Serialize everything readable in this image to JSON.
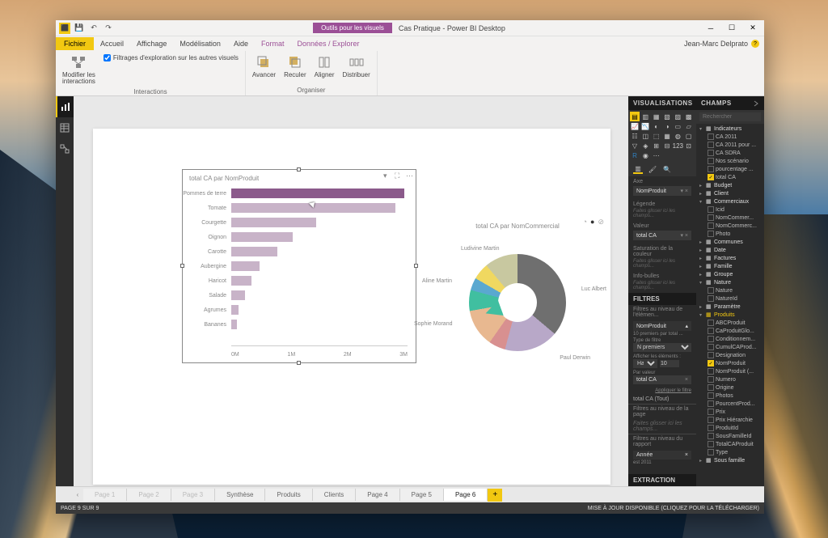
{
  "title_bar": {
    "contextual_tab": "Outils pour les visuels",
    "app_title": "Cas Pratique - Power BI Desktop",
    "user": "Jean-Marc Delprato"
  },
  "menu": {
    "file": "Fichier",
    "tabs": [
      "Accueil",
      "Affichage",
      "Modélisation",
      "Aide"
    ],
    "ctx_tabs": [
      "Format",
      "Données / Explorer"
    ]
  },
  "ribbon": {
    "interactions_group": "Interactions",
    "edit_btn": "Modifier les\ninteractions",
    "filter_check": "Filtrages d'exploration sur les autres visuels",
    "organiser_group": "Organiser",
    "avancer": "Avancer",
    "reculer": "Reculer",
    "aligner": "Aligner",
    "distribuer": "Distribuer"
  },
  "visualisations": {
    "header": "VISUALISATIONS",
    "axe_label": "Axe",
    "axe_field": "NomProduit",
    "legende_label": "Légende",
    "legende_placeholder": "Faites glisser ici les champs...",
    "valeur_label": "Valeur",
    "valeur_field": "total CA",
    "saturation_label": "Saturation de la couleur",
    "saturation_placeholder": "Faites glisser ici les champs...",
    "infobulles_label": "Info-bulles",
    "infobulles_placeholder": "Faites glisser ici les champs..."
  },
  "filtres": {
    "header": "FILTRES",
    "visual_level": "Filtres au niveau de l'élémen...",
    "nomproduit": "NomProduit",
    "sub": "10 premiers par total ...",
    "type_label": "Type de filtre",
    "type_value": "N premiers",
    "afficher_label": "Afficher les éléments :",
    "haut": "Haut",
    "haut_n": "10",
    "par_valeur": "Par valeur",
    "par_valeur_field": "total CA",
    "apply": "Appliquer le filtre",
    "totalca_tout": "total CA  (Tout)",
    "page_level": "Filtres au niveau de la page",
    "page_placeholder": "Faites glisser ici les champs...",
    "report_level": "Filtres au niveau du rapport",
    "annee": "Année",
    "annee_val": "est 2011"
  },
  "extraction": {
    "header": "EXTRACTION"
  },
  "champs": {
    "header": "CHAMPS",
    "search_placeholder": "Rechercher",
    "tree": [
      {
        "type": "table",
        "label": "Indicateurs",
        "expanded": true,
        "children": [
          {
            "label": "CA 2011",
            "checked": false
          },
          {
            "label": "CA 2011 pour ...",
            "checked": false
          },
          {
            "label": "CA SDRA",
            "checked": false
          },
          {
            "label": "Nos scénario",
            "checked": false
          },
          {
            "label": "pourcentage ...",
            "checked": false
          },
          {
            "label": "total CA",
            "checked": true
          }
        ]
      },
      {
        "type": "table",
        "label": "Budget",
        "expanded": false
      },
      {
        "type": "table",
        "label": "Client",
        "expanded": false
      },
      {
        "type": "table",
        "label": "Commerciaux",
        "expanded": true,
        "children": [
          {
            "label": "Icid",
            "checked": false
          },
          {
            "label": "NomCommer...",
            "checked": false
          },
          {
            "label": "NomCommerc...",
            "checked": false
          },
          {
            "label": "Photo",
            "checked": false
          }
        ]
      },
      {
        "type": "table",
        "label": "Communes",
        "expanded": false
      },
      {
        "type": "table",
        "label": "Date",
        "expanded": false
      },
      {
        "type": "table",
        "label": "Factures",
        "expanded": false
      },
      {
        "type": "table",
        "label": "Famille",
        "expanded": false
      },
      {
        "type": "table",
        "label": "Groupe",
        "expanded": false
      },
      {
        "type": "table",
        "label": "Nature",
        "expanded": true,
        "children": [
          {
            "label": "Nature",
            "checked": false
          },
          {
            "label": "NatureId",
            "checked": false
          }
        ]
      },
      {
        "type": "table",
        "label": "Paramètre",
        "expanded": false
      },
      {
        "type": "table",
        "label": "Produits",
        "expanded": true,
        "highlighted": true,
        "children": [
          {
            "label": "ABCProduit",
            "checked": false
          },
          {
            "label": "CaProduitGlo...",
            "checked": false
          },
          {
            "label": "Conditionnem...",
            "checked": false
          },
          {
            "label": "CumulCAProd...",
            "checked": false
          },
          {
            "label": "Designation",
            "checked": false
          },
          {
            "label": "NomProduit",
            "checked": true
          },
          {
            "label": "NomProduit (...",
            "checked": false
          },
          {
            "label": "Numero",
            "checked": false
          },
          {
            "label": "Origine",
            "checked": false
          },
          {
            "label": "Photos",
            "checked": false
          },
          {
            "label": "PourcentProd...",
            "checked": false
          },
          {
            "label": "Prix",
            "checked": false
          },
          {
            "label": "Prix Hiérarchie",
            "checked": false
          },
          {
            "label": "ProduitId",
            "checked": false
          },
          {
            "label": "SousFamilleId",
            "checked": false
          },
          {
            "label": "TotalCAProduit",
            "checked": false
          },
          {
            "label": "Type",
            "checked": false
          }
        ]
      },
      {
        "type": "table",
        "label": "Sous famille",
        "expanded": false
      }
    ]
  },
  "pages": {
    "nav_tabs": [
      {
        "label": "Page 1",
        "dim": true
      },
      {
        "label": "Page 2",
        "dim": true
      },
      {
        "label": "Page 3",
        "dim": true
      },
      {
        "label": "Synthèse",
        "dim": false
      },
      {
        "label": "Produits",
        "dim": false
      },
      {
        "label": "Clients",
        "dim": false
      },
      {
        "label": "Page 4",
        "dim": false
      },
      {
        "label": "Page 5",
        "dim": false
      },
      {
        "label": "Page 6",
        "dim": false,
        "active": true
      }
    ]
  },
  "status": {
    "left": "PAGE 9 SUR 9",
    "right": "MISE À JOUR DISPONIBLE (CLIQUEZ POUR LA TÉLÉCHARGER)"
  },
  "chart_data": [
    {
      "type": "bar",
      "title": "total CA par NomProduit",
      "orientation": "horizontal",
      "categories": [
        "Pommes de terre",
        "Tomate",
        "Courgette",
        "Oignon",
        "Carotte",
        "Aubergine",
        "Haricot",
        "Salade",
        "Agrumes",
        "Bananes"
      ],
      "values": [
        2950000,
        2800000,
        1450000,
        1050000,
        780000,
        480000,
        350000,
        230000,
        130000,
        90000
      ],
      "highlighted_index": 0,
      "xlabel": "",
      "ylabel": "",
      "xlim": [
        0,
        3000000
      ],
      "x_ticks": [
        "0M",
        "1M",
        "2M",
        "3M"
      ]
    },
    {
      "type": "pie",
      "title": "total CA par NomCommercial",
      "slices": [
        {
          "name": "Luc Albert",
          "value": 36,
          "color": "#6f6f6f"
        },
        {
          "name": "Paul Derwin",
          "value": 18,
          "color": "#b8a8c8"
        },
        {
          "name": "",
          "value": 6,
          "color": "#d89090"
        },
        {
          "name": "Sophie Morand",
          "value": 12,
          "color": "#e8b890"
        },
        {
          "name": "Aline Martin",
          "value": 7,
          "color": "#40bfa0"
        },
        {
          "name": "",
          "value": 4,
          "color": "#5aa8d0"
        },
        {
          "name": "Ludivine Martin",
          "value": 6,
          "color": "#f0d860"
        },
        {
          "name": "",
          "value": 11,
          "color": "#c8c8a0"
        }
      ]
    }
  ]
}
